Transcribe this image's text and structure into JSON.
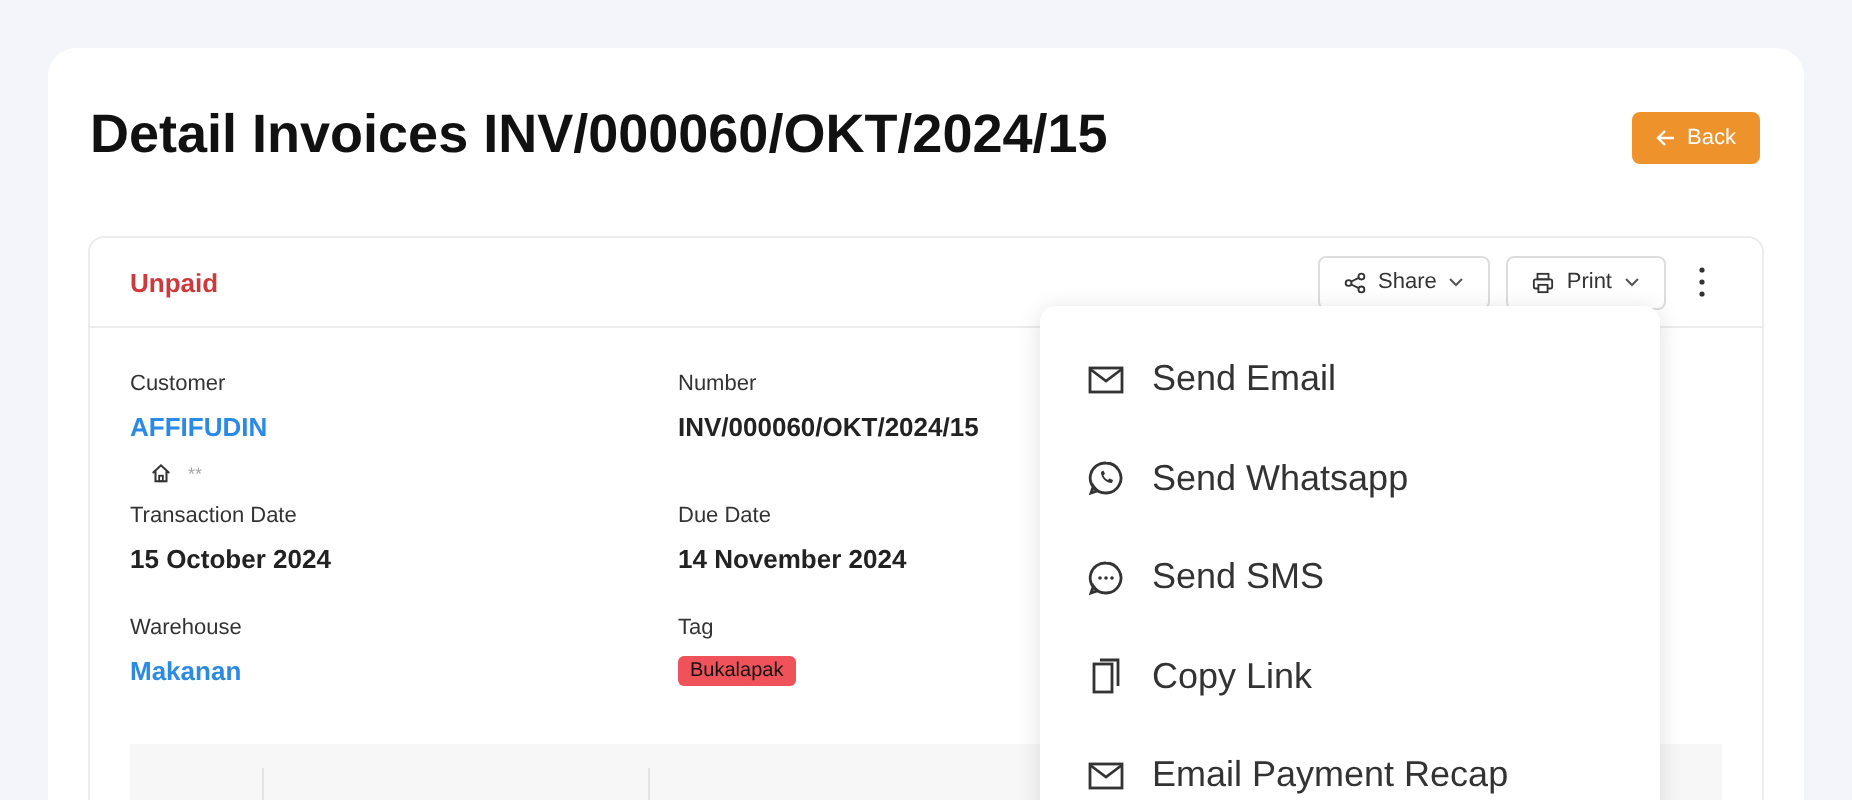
{
  "title": "Detail Invoices INV/000060/OKT/2024/15",
  "back_button": {
    "label": "Back"
  },
  "status": "Unpaid",
  "actions": [
    {
      "label": "Share",
      "kind": "share"
    },
    {
      "label": "Print",
      "kind": "print"
    }
  ],
  "details": [
    {
      "label": "Customer",
      "value": "AFFIFUDIN",
      "kind": "link",
      "address": "**"
    },
    {
      "label": "Number",
      "value": "INV/000060/OKT/2024/15",
      "kind": "text"
    },
    {
      "label": "Transaction Date",
      "value": "15 October 2024",
      "kind": "text"
    },
    {
      "label": "Due Date",
      "value": "14 November 2024",
      "kind": "text"
    },
    {
      "label": "Warehouse",
      "value": "Makanan",
      "kind": "link"
    },
    {
      "label": "Tag",
      "value": "Bukalapak",
      "kind": "tag",
      "color": "#f0525a"
    }
  ],
  "share_menu": [
    {
      "label": "Send Email",
      "kind": "email"
    },
    {
      "label": "Send Whatsapp",
      "kind": "whatsapp"
    },
    {
      "label": "Send SMS",
      "kind": "sms"
    },
    {
      "label": "Copy Link",
      "kind": "copy"
    },
    {
      "label": "Email Payment Recap",
      "kind": "email"
    }
  ]
}
